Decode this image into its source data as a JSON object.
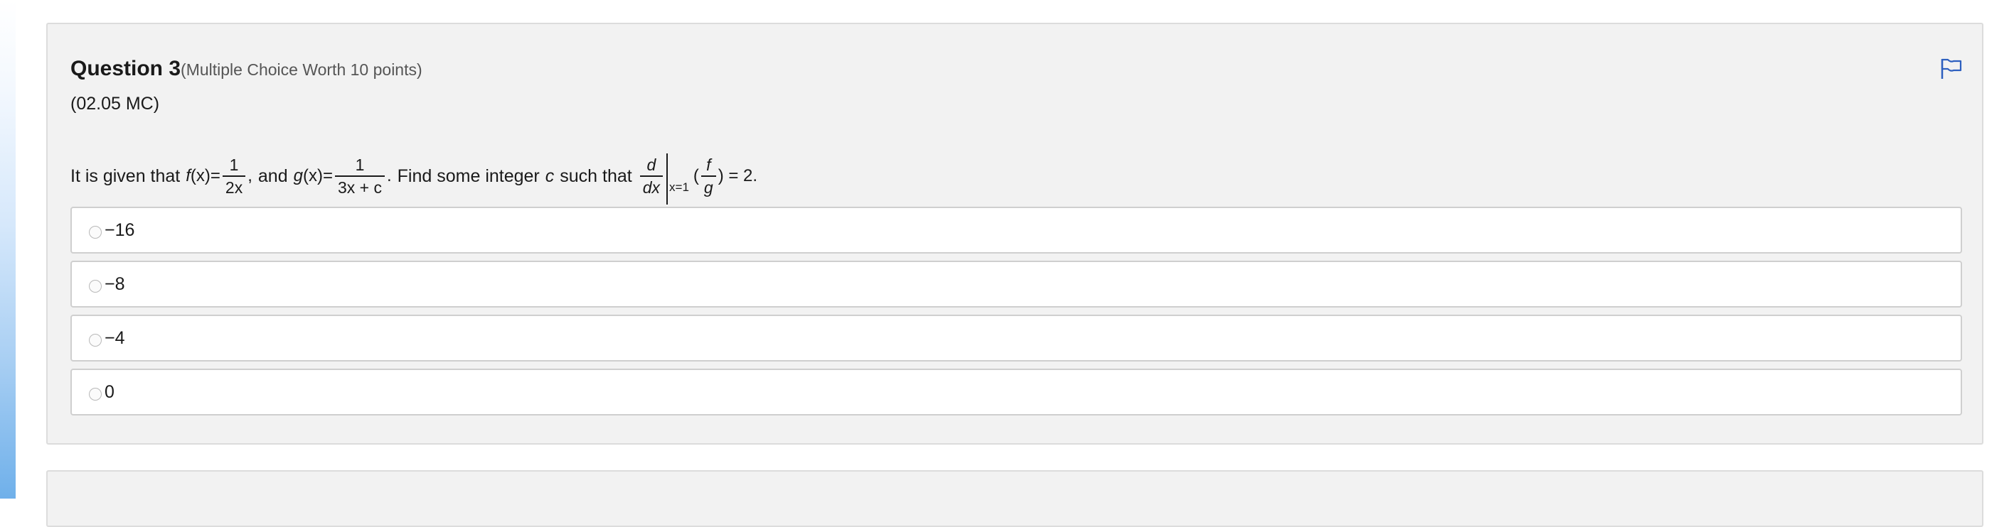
{
  "question": {
    "title": "Question 3",
    "worth": "(Multiple Choice Worth 10 points)",
    "code": "(02.05 MC)",
    "flag_icon": "flag-icon",
    "flag_color": "#2d5fbf",
    "stem": {
      "intro": "It is given that",
      "f_name": "f",
      "x_var": "(x)",
      "eq": "=",
      "f_num": "1",
      "f_den": "2x",
      "comma": ",",
      "and": "and",
      "g_name": "g",
      "g_num": "1",
      "g_den": "3x + c",
      "period": ".",
      "find": "Find some integer",
      "c_var": "c",
      "such_that": "such that",
      "d_num": "d",
      "d_den": "dx",
      "eval_at": "x=1",
      "open_paren": "(",
      "fg_num": "f",
      "fg_den": "g",
      "close_eq": ") = 2."
    },
    "choices": [
      {
        "label": "−16",
        "selected": false
      },
      {
        "label": "−8",
        "selected": false
      },
      {
        "label": "−4",
        "selected": false
      },
      {
        "label": "0",
        "selected": false
      }
    ]
  }
}
